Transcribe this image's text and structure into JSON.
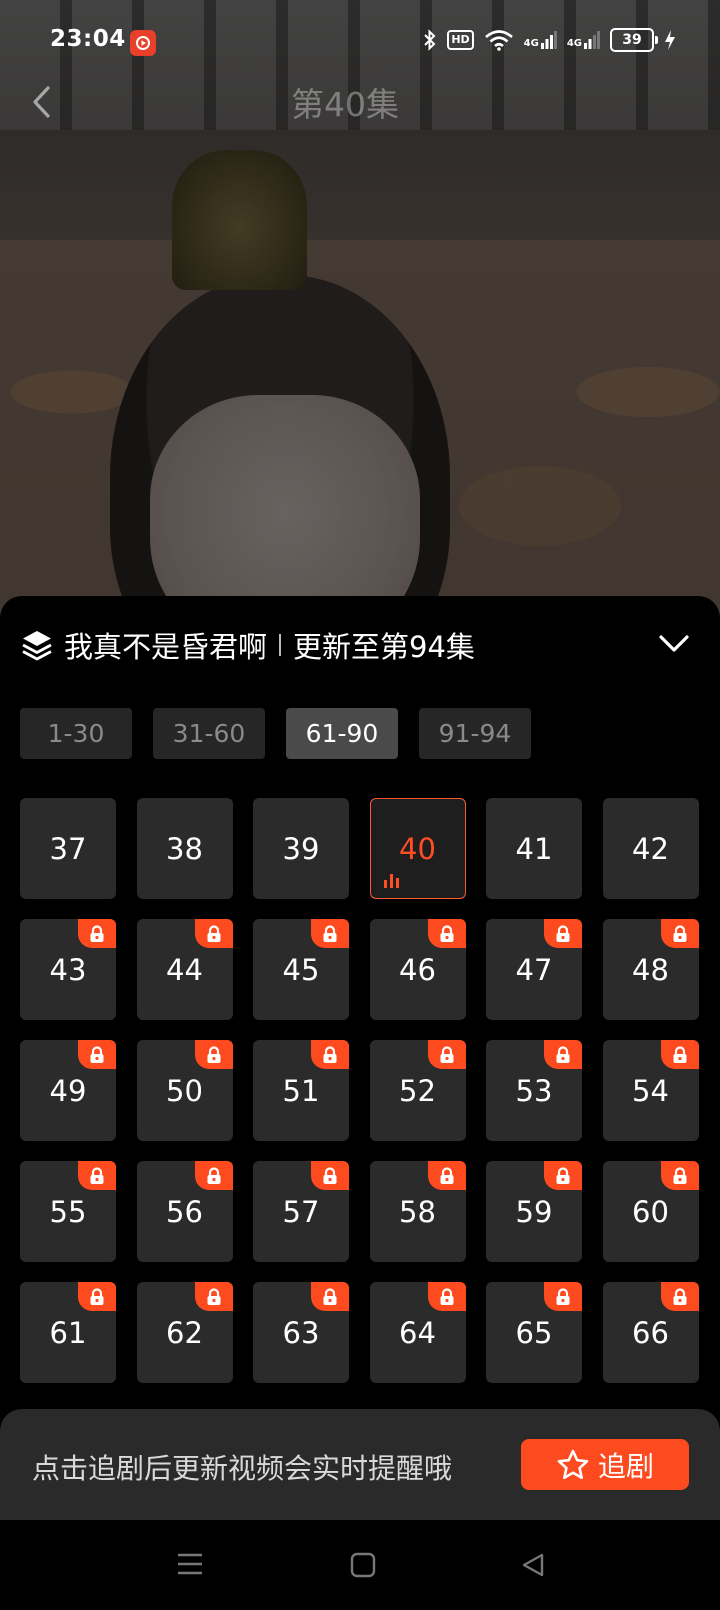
{
  "status_bar": {
    "time": "23:04",
    "battery": "39",
    "hd": "HD",
    "net1": "4G",
    "net2": "4G"
  },
  "nav": {
    "episode_title": "第40集"
  },
  "sheet": {
    "series_title": "我真不是昏君啊",
    "update_text": "更新至第94集",
    "range_tabs": [
      "1-30",
      "31-60",
      "61-90",
      "91-94"
    ],
    "active_range_index": 2,
    "episodes": [
      {
        "num": "37",
        "locked": false
      },
      {
        "num": "38",
        "locked": false
      },
      {
        "num": "39",
        "locked": false
      },
      {
        "num": "40",
        "locked": false,
        "current": true
      },
      {
        "num": "41",
        "locked": false
      },
      {
        "num": "42",
        "locked": false
      },
      {
        "num": "43",
        "locked": true
      },
      {
        "num": "44",
        "locked": true
      },
      {
        "num": "45",
        "locked": true
      },
      {
        "num": "46",
        "locked": true
      },
      {
        "num": "47",
        "locked": true
      },
      {
        "num": "48",
        "locked": true
      },
      {
        "num": "49",
        "locked": true
      },
      {
        "num": "50",
        "locked": true
      },
      {
        "num": "51",
        "locked": true
      },
      {
        "num": "52",
        "locked": true
      },
      {
        "num": "53",
        "locked": true
      },
      {
        "num": "54",
        "locked": true
      },
      {
        "num": "55",
        "locked": true
      },
      {
        "num": "56",
        "locked": true
      },
      {
        "num": "57",
        "locked": true
      },
      {
        "num": "58",
        "locked": true
      },
      {
        "num": "59",
        "locked": true
      },
      {
        "num": "60",
        "locked": true
      },
      {
        "num": "61",
        "locked": true
      },
      {
        "num": "62",
        "locked": true
      },
      {
        "num": "63",
        "locked": true
      },
      {
        "num": "64",
        "locked": true
      },
      {
        "num": "65",
        "locked": true
      },
      {
        "num": "66",
        "locked": true
      }
    ]
  },
  "follow": {
    "hint": "点击追剧后更新视频会实时提醒哦",
    "button_label": "追剧"
  },
  "colors": {
    "accent": "#fe4a1f",
    "tile": "#2b2b2b",
    "sheet_bg": "#000000"
  },
  "icons": {
    "back": "chevron-left-icon",
    "layers": "layers-icon",
    "collapse": "chevron-down-icon",
    "lock": "lock-icon",
    "playing": "equalizer-icon",
    "star": "star-icon"
  }
}
